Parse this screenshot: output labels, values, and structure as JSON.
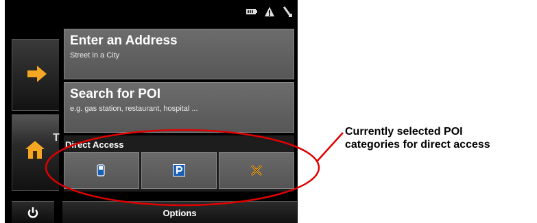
{
  "status_icons": [
    "battery-icon",
    "gps-signal-icon",
    "satellite-icon"
  ],
  "menu": {
    "items": [
      {
        "title": "Enter an Address",
        "subtitle": "Street in a City"
      },
      {
        "title": "Search for POI",
        "subtitle": "e.g. gas station, restaurant, hospital ..."
      }
    ]
  },
  "side": {
    "arrow_icon": "right-arrow-icon",
    "home_icon": "home-icon",
    "home_partial_text": "T",
    "power_icon": "power-icon"
  },
  "direct_access": {
    "label": "Direct Access",
    "buttons": [
      {
        "icon": "gas-station-icon"
      },
      {
        "icon": "parking-icon"
      },
      {
        "icon": "restaurant-icon"
      }
    ]
  },
  "options_label": "Options",
  "annotation": {
    "line1": "Currently selected POI",
    "line2": "categories for direct access"
  },
  "colors": {
    "accent": "#f5a623",
    "callout": "#e00000",
    "poi_blue": "#1a5fb4",
    "tile": "#626262"
  }
}
